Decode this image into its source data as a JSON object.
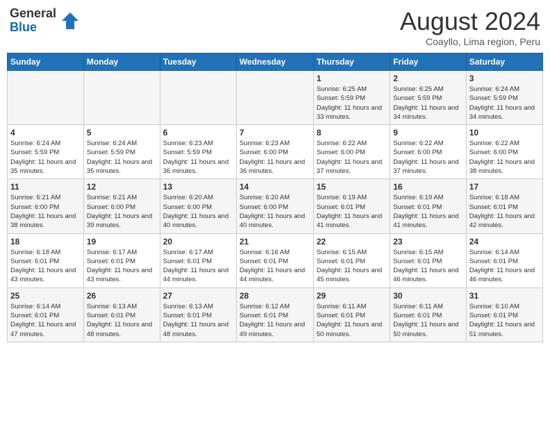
{
  "header": {
    "logo": {
      "general": "General",
      "blue": "Blue"
    },
    "title": "August 2024",
    "location": "Coayllo, Lima region, Peru"
  },
  "weekdays": [
    "Sunday",
    "Monday",
    "Tuesday",
    "Wednesday",
    "Thursday",
    "Friday",
    "Saturday"
  ],
  "weeks": [
    [
      {
        "day": "",
        "info": ""
      },
      {
        "day": "",
        "info": ""
      },
      {
        "day": "",
        "info": ""
      },
      {
        "day": "",
        "info": ""
      },
      {
        "day": "1",
        "info": "Sunrise: 6:25 AM\nSunset: 5:59 PM\nDaylight: 11 hours and 33 minutes."
      },
      {
        "day": "2",
        "info": "Sunrise: 6:25 AM\nSunset: 5:59 PM\nDaylight: 11 hours and 34 minutes."
      },
      {
        "day": "3",
        "info": "Sunrise: 6:24 AM\nSunset: 5:59 PM\nDaylight: 11 hours and 34 minutes."
      }
    ],
    [
      {
        "day": "4",
        "info": "Sunrise: 6:24 AM\nSunset: 5:59 PM\nDaylight: 11 hours and 35 minutes."
      },
      {
        "day": "5",
        "info": "Sunrise: 6:24 AM\nSunset: 5:59 PM\nDaylight: 11 hours and 35 minutes."
      },
      {
        "day": "6",
        "info": "Sunrise: 6:23 AM\nSunset: 5:59 PM\nDaylight: 11 hours and 36 minutes."
      },
      {
        "day": "7",
        "info": "Sunrise: 6:23 AM\nSunset: 6:00 PM\nDaylight: 11 hours and 36 minutes."
      },
      {
        "day": "8",
        "info": "Sunrise: 6:22 AM\nSunset: 6:00 PM\nDaylight: 11 hours and 37 minutes."
      },
      {
        "day": "9",
        "info": "Sunrise: 6:22 AM\nSunset: 6:00 PM\nDaylight: 11 hours and 37 minutes."
      },
      {
        "day": "10",
        "info": "Sunrise: 6:22 AM\nSunset: 6:00 PM\nDaylight: 11 hours and 38 minutes."
      }
    ],
    [
      {
        "day": "11",
        "info": "Sunrise: 6:21 AM\nSunset: 6:00 PM\nDaylight: 11 hours and 38 minutes."
      },
      {
        "day": "12",
        "info": "Sunrise: 6:21 AM\nSunset: 6:00 PM\nDaylight: 11 hours and 39 minutes."
      },
      {
        "day": "13",
        "info": "Sunrise: 6:20 AM\nSunset: 6:00 PM\nDaylight: 11 hours and 40 minutes."
      },
      {
        "day": "14",
        "info": "Sunrise: 6:20 AM\nSunset: 6:00 PM\nDaylight: 11 hours and 40 minutes."
      },
      {
        "day": "15",
        "info": "Sunrise: 6:19 AM\nSunset: 6:01 PM\nDaylight: 11 hours and 41 minutes."
      },
      {
        "day": "16",
        "info": "Sunrise: 6:19 AM\nSunset: 6:01 PM\nDaylight: 11 hours and 41 minutes."
      },
      {
        "day": "17",
        "info": "Sunrise: 6:18 AM\nSunset: 6:01 PM\nDaylight: 11 hours and 42 minutes."
      }
    ],
    [
      {
        "day": "18",
        "info": "Sunrise: 6:18 AM\nSunset: 6:01 PM\nDaylight: 11 hours and 43 minutes."
      },
      {
        "day": "19",
        "info": "Sunrise: 6:17 AM\nSunset: 6:01 PM\nDaylight: 11 hours and 43 minutes."
      },
      {
        "day": "20",
        "info": "Sunrise: 6:17 AM\nSunset: 6:01 PM\nDaylight: 11 hours and 44 minutes."
      },
      {
        "day": "21",
        "info": "Sunrise: 6:16 AM\nSunset: 6:01 PM\nDaylight: 11 hours and 44 minutes."
      },
      {
        "day": "22",
        "info": "Sunrise: 6:15 AM\nSunset: 6:01 PM\nDaylight: 11 hours and 45 minutes."
      },
      {
        "day": "23",
        "info": "Sunrise: 6:15 AM\nSunset: 6:01 PM\nDaylight: 11 hours and 46 minutes."
      },
      {
        "day": "24",
        "info": "Sunrise: 6:14 AM\nSunset: 6:01 PM\nDaylight: 11 hours and 46 minutes."
      }
    ],
    [
      {
        "day": "25",
        "info": "Sunrise: 6:14 AM\nSunset: 6:01 PM\nDaylight: 11 hours and 47 minutes."
      },
      {
        "day": "26",
        "info": "Sunrise: 6:13 AM\nSunset: 6:01 PM\nDaylight: 11 hours and 48 minutes."
      },
      {
        "day": "27",
        "info": "Sunrise: 6:13 AM\nSunset: 6:01 PM\nDaylight: 11 hours and 48 minutes."
      },
      {
        "day": "28",
        "info": "Sunrise: 6:12 AM\nSunset: 6:01 PM\nDaylight: 11 hours and 49 minutes."
      },
      {
        "day": "29",
        "info": "Sunrise: 6:11 AM\nSunset: 6:01 PM\nDaylight: 11 hours and 50 minutes."
      },
      {
        "day": "30",
        "info": "Sunrise: 6:11 AM\nSunset: 6:01 PM\nDaylight: 11 hours and 50 minutes."
      },
      {
        "day": "31",
        "info": "Sunrise: 6:10 AM\nSunset: 6:01 PM\nDaylight: 11 hours and 51 minutes."
      }
    ]
  ]
}
